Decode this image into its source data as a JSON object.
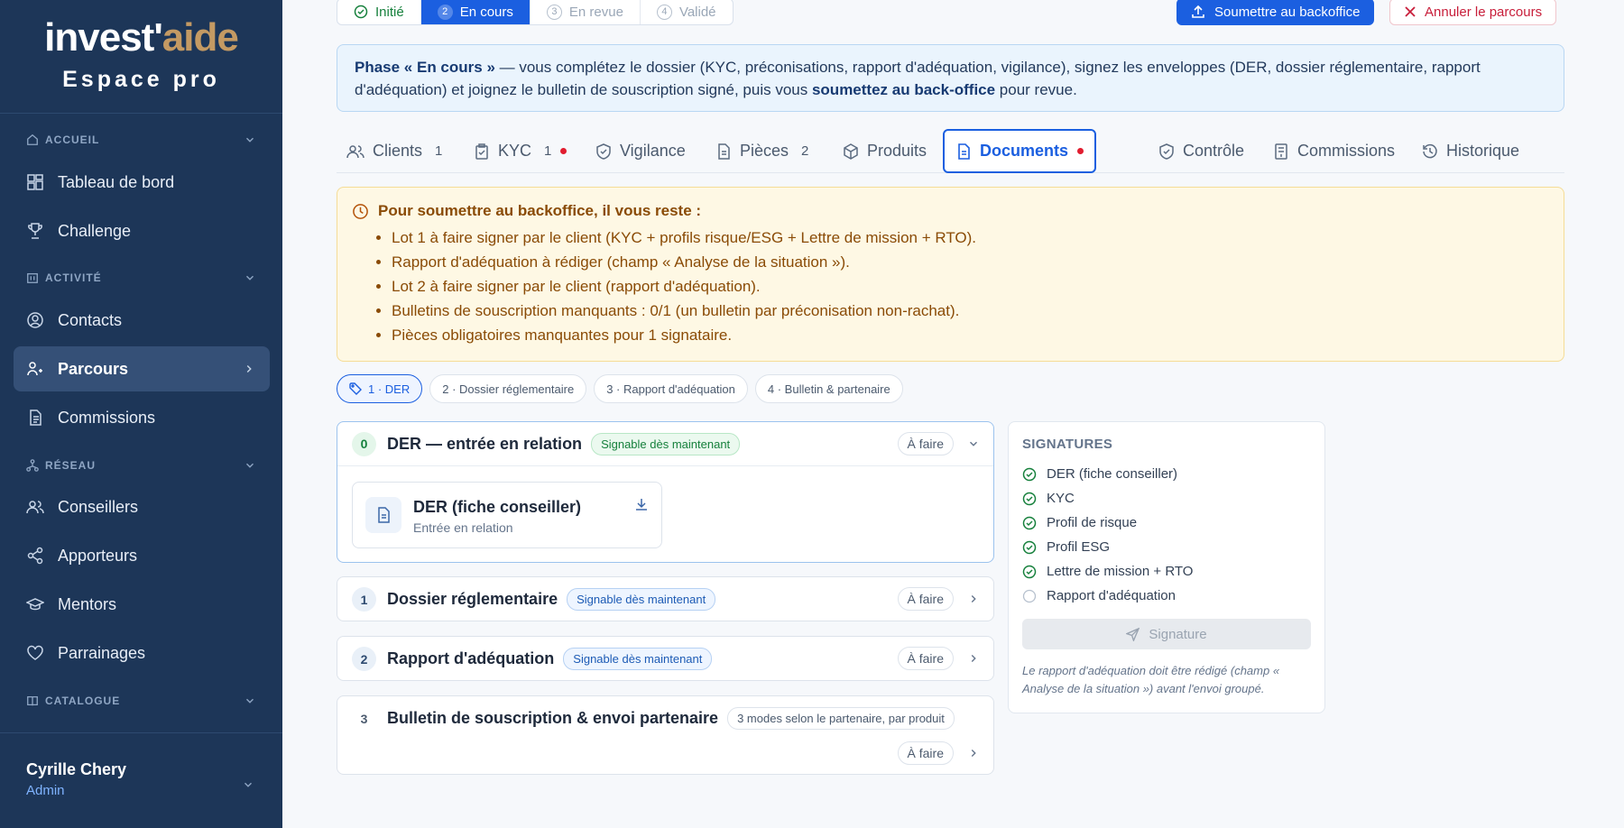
{
  "brand": {
    "logo_main": "invest'",
    "logo_accent": "aide",
    "subtitle": "Espace pro"
  },
  "sidebar": {
    "sections": [
      {
        "label": "ACCUEIL",
        "icon": "home-icon"
      },
      {
        "label": "ACTIVITÉ",
        "icon": "building-icon"
      },
      {
        "label": "RÉSEAU",
        "icon": "network-icon"
      },
      {
        "label": "CATALOGUE",
        "icon": "book-icon"
      }
    ],
    "items": [
      {
        "label": "Tableau de bord",
        "icon": "dashboard-icon"
      },
      {
        "label": "Challenge",
        "icon": "trophy-icon"
      },
      {
        "label": "Contacts",
        "icon": "user-circle-icon"
      },
      {
        "label": "Parcours",
        "icon": "route-icon",
        "active": true
      },
      {
        "label": "Commissions",
        "icon": "document-icon"
      },
      {
        "label": "Conseillers",
        "icon": "users-icon"
      },
      {
        "label": "Apporteurs",
        "icon": "share-icon"
      },
      {
        "label": "Mentors",
        "icon": "graduation-icon"
      },
      {
        "label": "Parrainages",
        "icon": "heart-icon"
      }
    ],
    "user": {
      "name": "Cyrille Chery",
      "role": "Admin"
    }
  },
  "steps": [
    {
      "num": "",
      "label": "Initié",
      "state": "done"
    },
    {
      "num": "2",
      "label": "En cours",
      "state": "current"
    },
    {
      "num": "3",
      "label": "En revue",
      "state": "todo"
    },
    {
      "num": "4",
      "label": "Validé",
      "state": "todo"
    }
  ],
  "actions": {
    "submit": "Soumettre au backoffice",
    "cancel": "Annuler le parcours"
  },
  "banner": {
    "phase": "Phase « En cours »",
    "text1": " — vous complétez le dossier (KYC, préconisations, rapport d'adéquation, vigilance), signez les enveloppes (DER, dossier réglementaire, rapport d'adéquation) et joignez le bulletin de souscription signé, puis vous ",
    "bold2": "soumettez au back-office",
    "text2": " pour revue."
  },
  "tabs": [
    {
      "label": "Clients",
      "count": "1",
      "icon": "users-icon"
    },
    {
      "label": "KYC",
      "count": "1",
      "dot": true,
      "icon": "clipboard-icon"
    },
    {
      "label": "Vigilance",
      "icon": "shield-icon"
    },
    {
      "label": "Pièces",
      "count": "2",
      "icon": "file-icon"
    },
    {
      "label": "Produits",
      "icon": "box-icon"
    },
    {
      "label": "Documents",
      "dot": true,
      "active": true,
      "icon": "document-icon"
    },
    {
      "label": "Contrôle",
      "icon": "shield-check-icon"
    },
    {
      "label": "Commissions",
      "icon": "receipt-icon"
    },
    {
      "label": "Historique",
      "icon": "history-icon"
    }
  ],
  "warning": {
    "title": "Pour soumettre au backoffice, il vous reste :",
    "items": [
      "Lot 1 à faire signer par le client (KYC + profils risque/ESG + Lettre de mission + RTO).",
      "Rapport d'adéquation à rédiger (champ « Analyse de la situation »).",
      "Lot 2 à faire signer par le client (rapport d'adéquation).",
      "Bulletins de souscription manquants : 0/1 (un bulletin par préconisation non-rachat).",
      "Pièces obligatoires manquantes pour 1 signataire."
    ]
  },
  "chips": [
    {
      "label": "1 · DER",
      "active": true
    },
    {
      "label": "2 · Dossier réglementaire"
    },
    {
      "label": "3 · Rapport d'adéquation"
    },
    {
      "label": "4 · Bulletin & partenaire"
    }
  ],
  "cards": [
    {
      "num": "0",
      "title": "DER — entrée en relation",
      "badge": "Signable dès maintenant",
      "status": "À faire",
      "doc": {
        "title": "DER (fiche conseiller)",
        "sub": "Entrée en relation"
      }
    },
    {
      "num": "1",
      "title": "Dossier réglementaire",
      "badge": "Signable dès maintenant",
      "status": "À faire"
    },
    {
      "num": "2",
      "title": "Rapport d'adéquation",
      "badge": "Signable dès maintenant",
      "status": "À faire"
    },
    {
      "num": "3",
      "title": "Bulletin de souscription & envoi partenaire",
      "badge": "3 modes selon le partenaire, par produit",
      "status": "À faire"
    }
  ],
  "signatures": {
    "title": "SIGNATURES",
    "items": [
      {
        "label": "DER (fiche conseiller)",
        "done": true
      },
      {
        "label": "KYC",
        "done": true
      },
      {
        "label": "Profil de risque",
        "done": true
      },
      {
        "label": "Profil ESG",
        "done": true
      },
      {
        "label": "Lettre de mission + RTO",
        "done": true
      },
      {
        "label": "Rapport d'adéquation",
        "done": false
      }
    ],
    "button": "Signature",
    "note": "Le rapport d'adéquation doit être rédigé (champ « Analyse de la situation ») avant l'envoi groupé."
  },
  "colors": {
    "sidebar": "#1d3658",
    "accent": "#1b5fe0",
    "brand_gold": "#c49a63",
    "danger": "#c81e3a",
    "success": "#16803c",
    "warning": "#8a4b06"
  }
}
